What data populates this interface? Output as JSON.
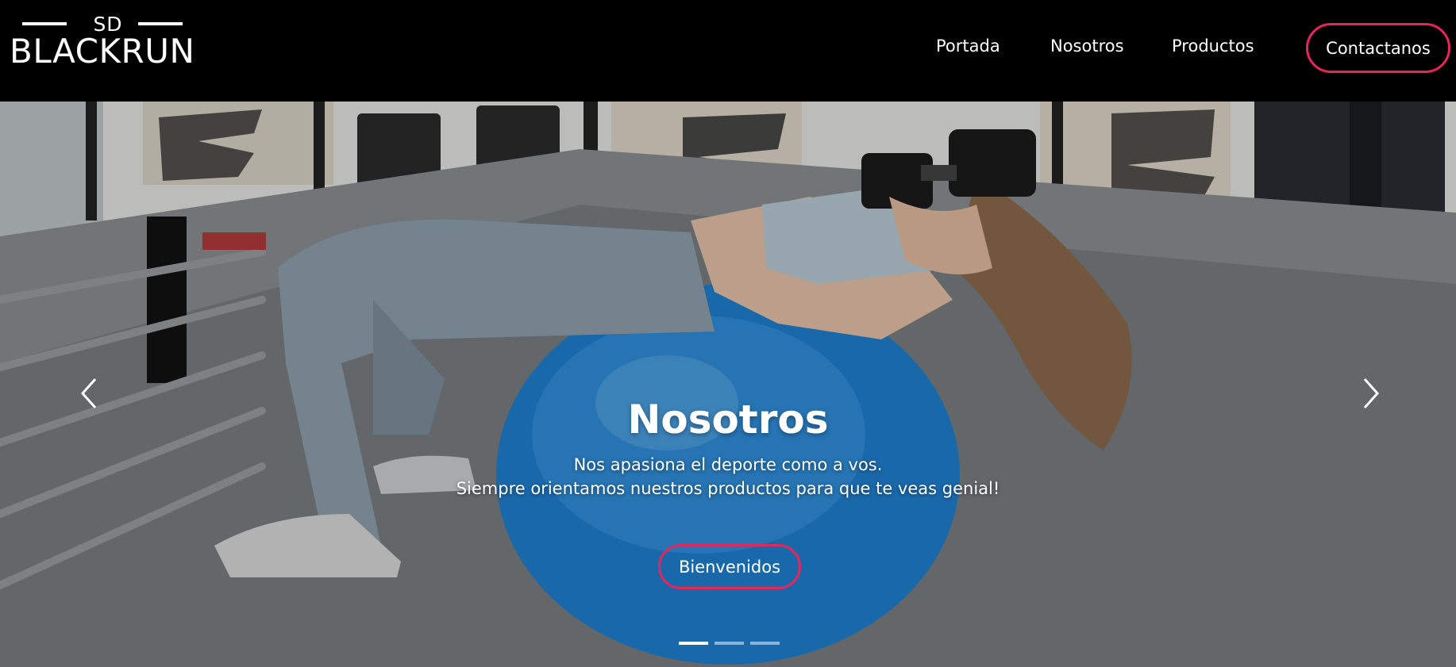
{
  "brand": {
    "prefix": "SD",
    "name": "BLACKRUN"
  },
  "nav": {
    "items": [
      {
        "label": "Portada"
      },
      {
        "label": "Nosotros"
      },
      {
        "label": "Productos"
      }
    ],
    "cta_label": "Contactanos"
  },
  "hero": {
    "title": "Nosotros",
    "line1": "Nos apasiona el deporte como a vos.",
    "line2": "Siempre orientamos nuestros productos para que te veas genial!",
    "button_label": "Bienvenidos",
    "slides_count": 3,
    "active_slide": 1
  },
  "colors": {
    "accent": "#e8245a",
    "navbar_bg": "#000000",
    "ball": "#1f7fd0"
  },
  "icons": {
    "prev": "chevron-left-icon",
    "next": "chevron-right-icon"
  }
}
